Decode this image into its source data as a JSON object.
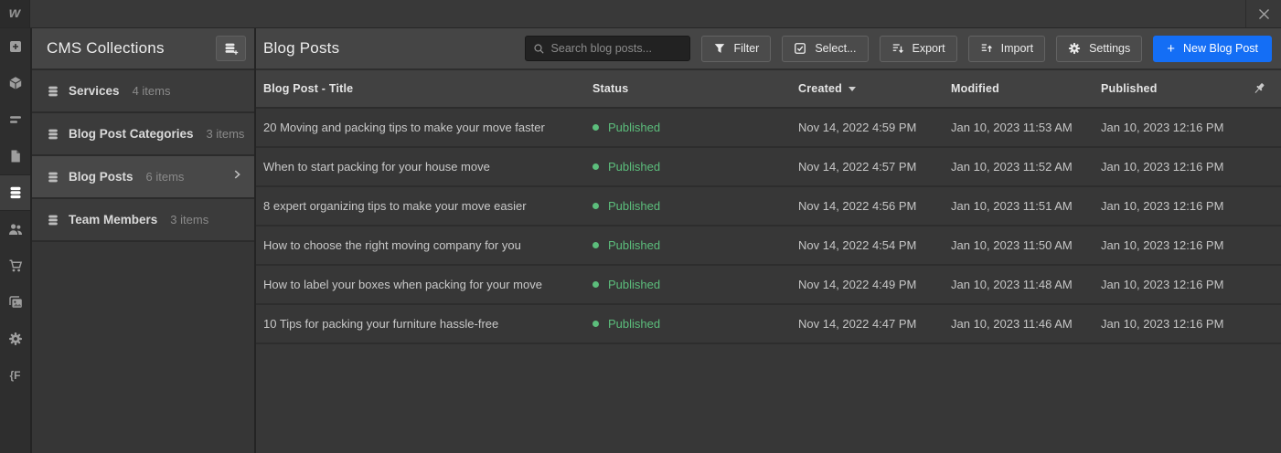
{
  "topbar": {
    "logo_text": "w"
  },
  "rail": {
    "code_label": "{F"
  },
  "collections_panel": {
    "title": "CMS Collections",
    "items": [
      {
        "name": "Services",
        "count": "4 items",
        "selected": false
      },
      {
        "name": "Blog Post Categories",
        "count": "3 items",
        "selected": false
      },
      {
        "name": "Blog Posts",
        "count": "6 items",
        "selected": true
      },
      {
        "name": "Team Members",
        "count": "3 items",
        "selected": false
      }
    ]
  },
  "main": {
    "title": "Blog Posts",
    "search": {
      "placeholder": "Search blog posts..."
    },
    "toolbar": {
      "filter": "Filter",
      "select": "Select...",
      "export": "Export",
      "import": "Import",
      "settings": "Settings",
      "new_post_plus": "+",
      "new_post": "New Blog Post"
    },
    "table": {
      "columns": {
        "title": "Blog Post - Title",
        "status": "Status",
        "created": "Created",
        "modified": "Modified",
        "published": "Published"
      },
      "sorted_by": "Created",
      "rows": [
        {
          "title": "20 Moving and packing tips to make your move faster",
          "status": "Published",
          "created": "Nov 14, 2022 4:59 PM",
          "modified": "Jan 10, 2023 11:53 AM",
          "published": "Jan 10, 2023 12:16 PM"
        },
        {
          "title": "When to start packing for your house move",
          "status": "Published",
          "created": "Nov 14, 2022 4:57 PM",
          "modified": "Jan 10, 2023 11:52 AM",
          "published": "Jan 10, 2023 12:16 PM"
        },
        {
          "title": "8 expert organizing tips to make your move easier",
          "status": "Published",
          "created": "Nov 14, 2022 4:56 PM",
          "modified": "Jan 10, 2023 11:51 AM",
          "published": "Jan 10, 2023 12:16 PM"
        },
        {
          "title": "How to choose the right moving company for you",
          "status": "Published",
          "created": "Nov 14, 2022 4:54 PM",
          "modified": "Jan 10, 2023 11:50 AM",
          "published": "Jan 10, 2023 12:16 PM"
        },
        {
          "title": "How to label your boxes when packing for your move",
          "status": "Published",
          "created": "Nov 14, 2022 4:49 PM",
          "modified": "Jan 10, 2023 11:48 AM",
          "published": "Jan 10, 2023 12:16 PM"
        },
        {
          "title": "10 Tips for packing your furniture hassle-free",
          "status": "Published",
          "created": "Nov 14, 2022 4:47 PM",
          "modified": "Jan 10, 2023 11:46 AM",
          "published": "Jan 10, 2023 12:16 PM"
        }
      ]
    }
  },
  "colors": {
    "accent_blue": "#146ef5",
    "published_green": "#5cbe7c"
  }
}
